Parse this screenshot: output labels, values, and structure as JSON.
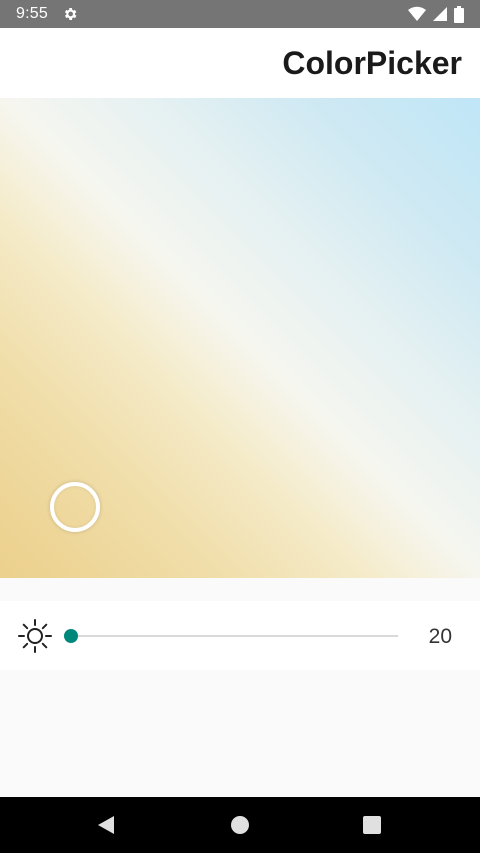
{
  "status_bar": {
    "time": "9:55",
    "icons": [
      "settings-icon",
      "wifi-icon",
      "signal-icon",
      "battery-icon"
    ]
  },
  "app_bar": {
    "title": "ColorPicker"
  },
  "color_plane": {
    "gradient_colors": {
      "bottom_left": "#ecd08c",
      "center": "#f6f6ef",
      "top_right": "#bfe6f7"
    },
    "thumb_icon": "selection-ring"
  },
  "brightness": {
    "icon": "brightness-icon",
    "value": "20",
    "slider_fraction": 0.0,
    "accent_color": "#00897b"
  },
  "nav_bar": {
    "icons": [
      "back-icon",
      "home-icon",
      "recents-icon"
    ]
  }
}
